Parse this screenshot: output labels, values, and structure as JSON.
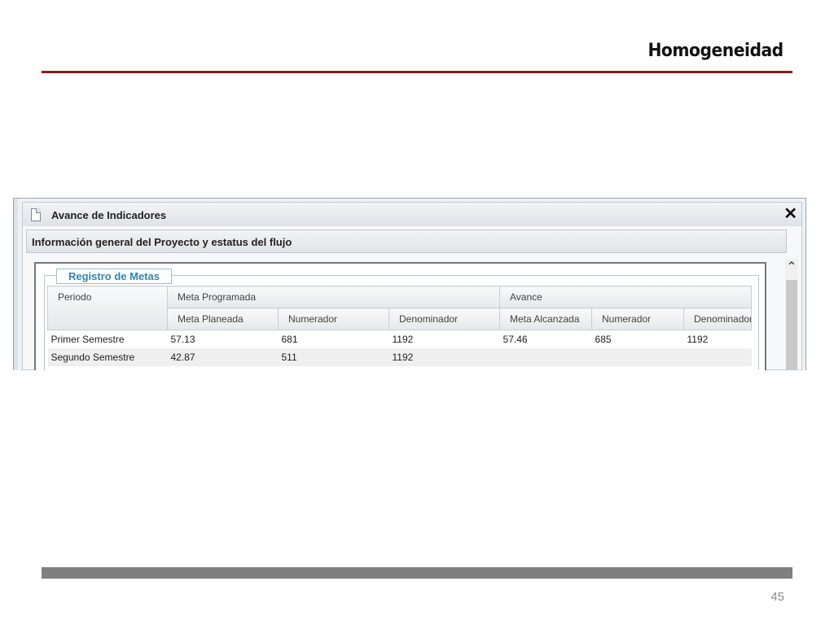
{
  "slide": {
    "title": "Homogeneidad",
    "page_number": "45",
    "accent_color": "#8b1a1a"
  },
  "window": {
    "title": "Avance de Indicadores",
    "icon": "document-icon",
    "close_glyph": "✕",
    "section_title": "Información general del Proyecto y estatus del flujo",
    "scroll_up_glyph": "⌃"
  },
  "fieldset": {
    "legend": "Registro de Metas"
  },
  "table": {
    "group_headers": [
      "Periodo",
      "Meta Programada",
      "Avance"
    ],
    "sub_headers": [
      "Meta Planeada",
      "Numerador",
      "Denominador",
      "Meta Alcanzada",
      "Numerador",
      "Denominador"
    ],
    "rows": [
      [
        "Primer Semestre",
        "57.13",
        "681",
        "1192",
        "57.46",
        "685",
        "1192"
      ],
      [
        "Segundo Semestre",
        "42.87",
        "511",
        "1192",
        "",
        "",
        ""
      ]
    ]
  }
}
